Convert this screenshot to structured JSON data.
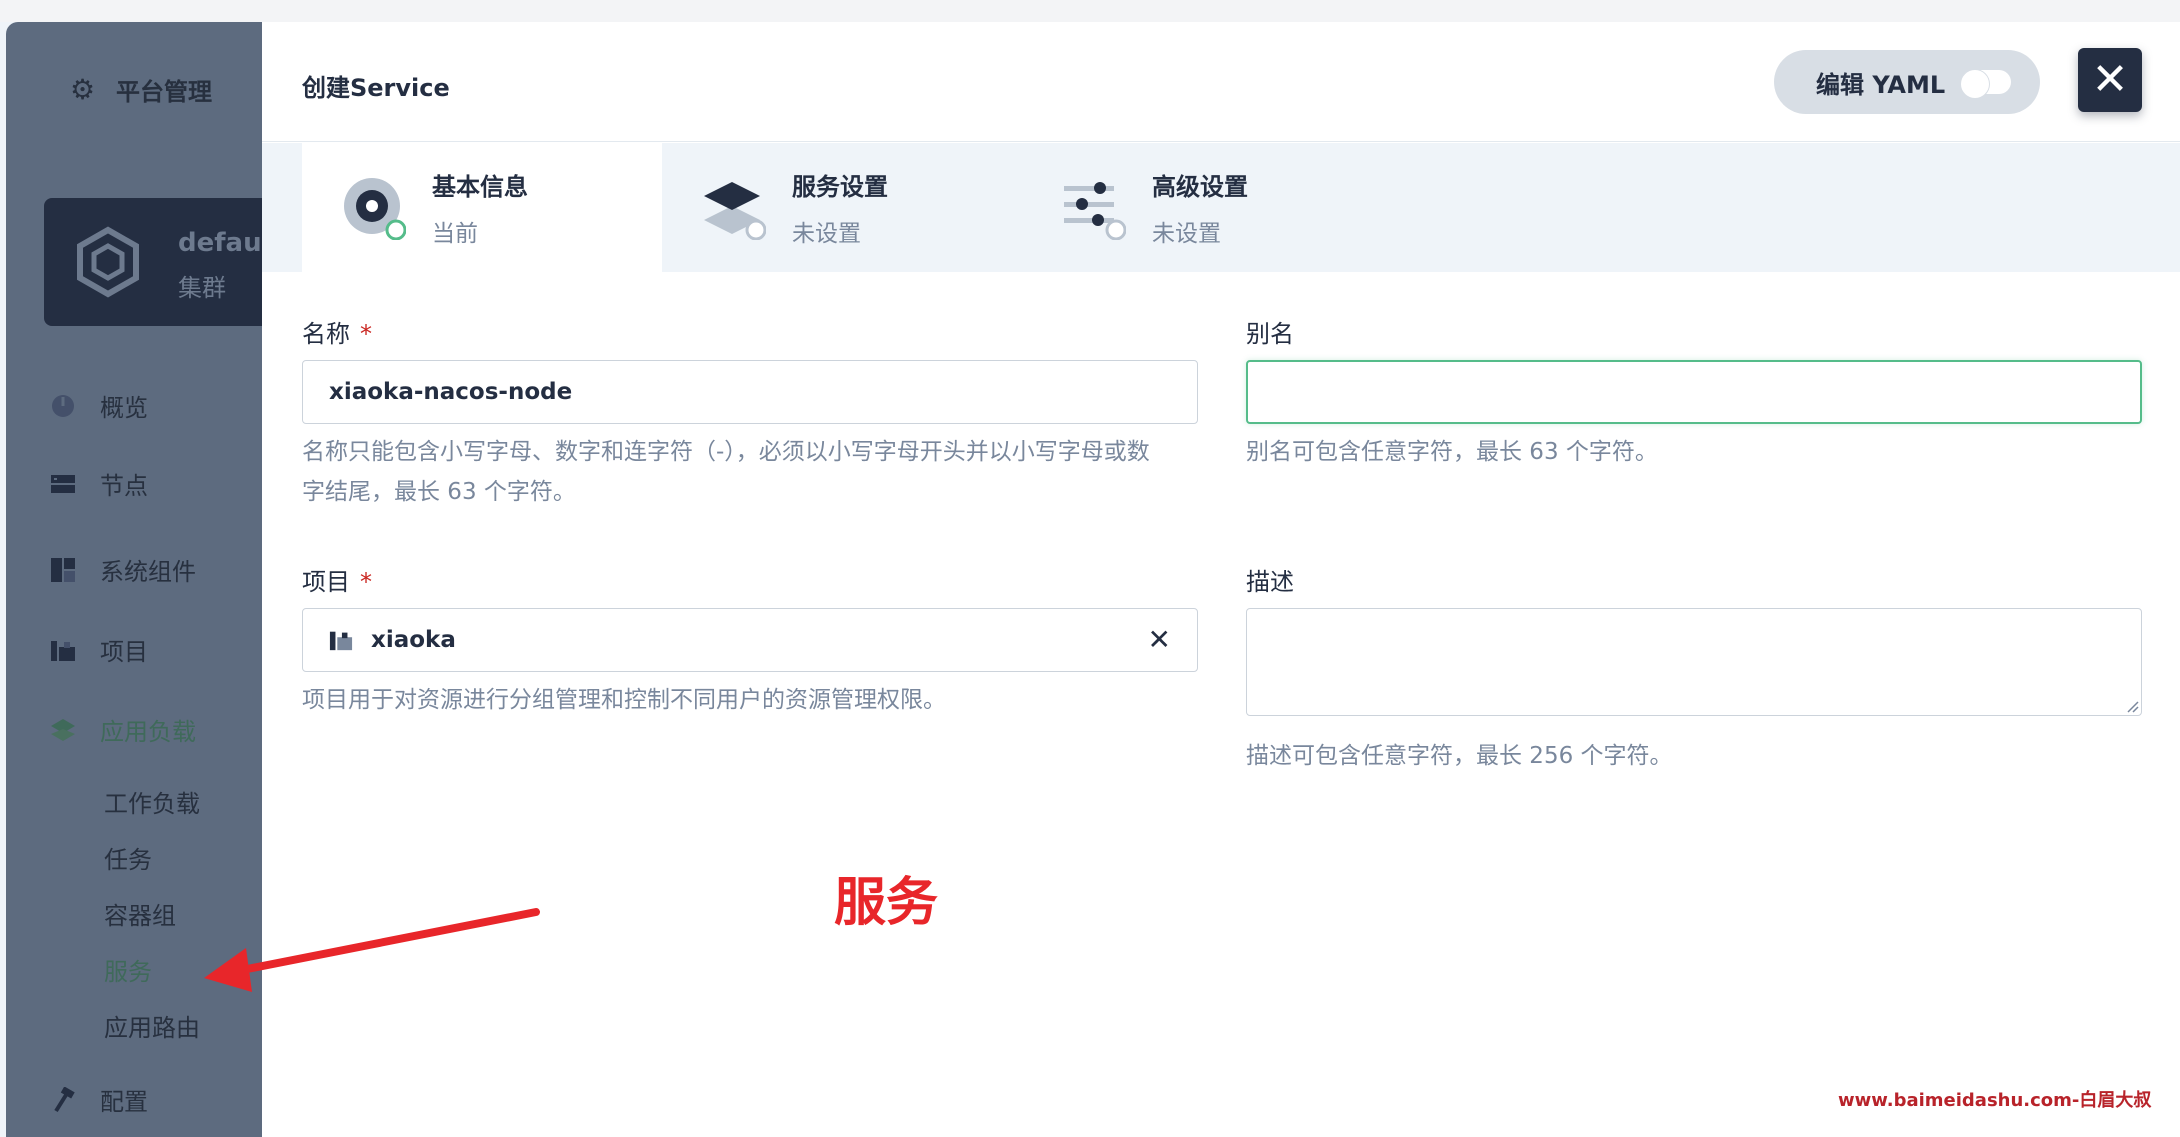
{
  "sidebar": {
    "title": "平台管理",
    "cluster": {
      "name": "default",
      "type": "集群"
    },
    "items": [
      {
        "label": "概览",
        "icon": "dashboard-icon"
      },
      {
        "label": "节点",
        "icon": "server-icon"
      },
      {
        "label": "系统组件",
        "icon": "components-icon"
      },
      {
        "label": "项目",
        "icon": "project-icon"
      },
      {
        "label": "应用负载",
        "icon": "layers-icon"
      }
    ],
    "subitems": [
      "工作负载",
      "任务",
      "容器组",
      "服务",
      "应用路由"
    ],
    "config_label": "配置"
  },
  "modal": {
    "title": "创建Service",
    "yaml_label": "编辑 YAML",
    "steps": [
      {
        "name": "基本信息",
        "status": "当前"
      },
      {
        "name": "服务设置",
        "status": "未设置"
      },
      {
        "name": "高级设置",
        "status": "未设置"
      }
    ],
    "form": {
      "name_label": "名称",
      "name_required": "*",
      "name_value": "xiaoka-nacos-node",
      "name_hint_1": "名称只能包含小写字母、数字和连字符（-），必须以小写字母开头并以小写字母或数",
      "name_hint_2": "字结尾，最长 63 个字符。",
      "alias_label": "别名",
      "alias_value": "",
      "alias_hint": "别名可包含任意字符，最长 63 个字符。",
      "project_label": "项目",
      "project_required": "*",
      "project_value": "xiaoka",
      "project_hint": "项目用于对资源进行分组管理和控制不同用户的资源管理权限。",
      "desc_label": "描述",
      "desc_hint": "描述可包含任意字符，最长 256 个字符。"
    }
  },
  "annotation": {
    "text": "服务",
    "color": "#e8262a"
  },
  "watermark": "www.baimeidashu.com-白眉大叔",
  "colors": {
    "accent": "#55bc8a",
    "dark": "#242e42",
    "sidebar": "#5d6b7f"
  }
}
